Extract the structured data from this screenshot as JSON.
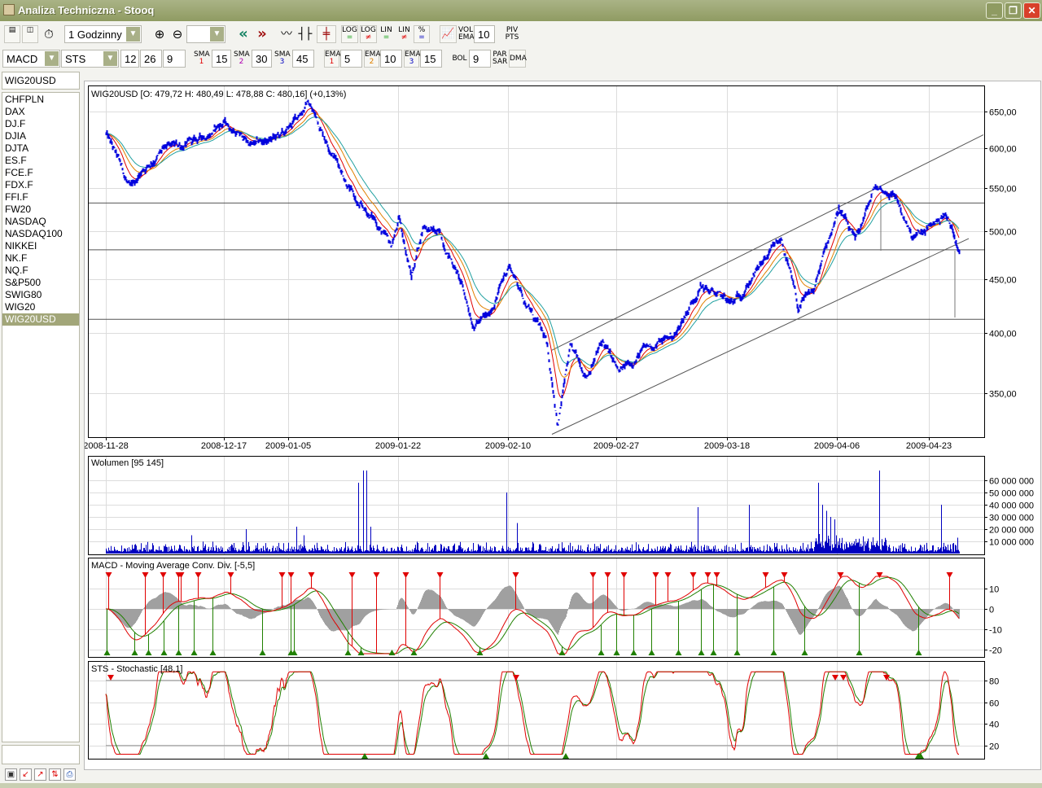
{
  "window": {
    "title": "Analiza Techniczna - Stooq",
    "minimize": "_",
    "restore": "❐",
    "close": "✕"
  },
  "toolbar1": {
    "interval": "1 Godzinny",
    "zoom_select": "",
    "log_eq": [
      "LOG",
      "="
    ],
    "log_neq": [
      "LOG",
      "≠"
    ],
    "lin_eq": [
      "LIN",
      "="
    ],
    "lin_neq": [
      "LIN",
      "≠"
    ],
    "pct": [
      "%",
      "="
    ],
    "vol_ema": [
      "VOL",
      "EMA"
    ],
    "vol_ema_value": "10",
    "piv_pts": [
      "PIV",
      "PTS"
    ],
    "back": "«",
    "forward": "»"
  },
  "toolbar2": {
    "indicator1": "MACD",
    "indicator2": "STS",
    "macd_params": [
      "12",
      "26",
      "9"
    ],
    "sma": [
      {
        "label": "SMA",
        "n": "1",
        "value": "15",
        "color": "#e00000"
      },
      {
        "label": "SMA",
        "n": "2",
        "value": "30",
        "color": "#b000b0"
      },
      {
        "label": "SMA",
        "n": "3",
        "value": "45",
        "color": "#0000c0"
      }
    ],
    "ema": [
      {
        "label": "EMA",
        "n": "1",
        "value": "5",
        "color": "#e00000"
      },
      {
        "label": "EMA",
        "n": "2",
        "value": "10",
        "color": "#e08000"
      },
      {
        "label": "EMA",
        "n": "3",
        "value": "15",
        "color": "#0000c0"
      }
    ],
    "bol": "BOL",
    "bol_value": "9",
    "par_sar": [
      "PAR",
      "SAR"
    ],
    "dma": "DMA"
  },
  "sidebar": {
    "search": "WIG20USD",
    "items": [
      "CHFPLN",
      "DAX",
      "DJ.F",
      "DJIA",
      "DJTA",
      "ES.F",
      "FCE.F",
      "FDX.F",
      "FFI.F",
      "FW20",
      "NASDAQ",
      "NASDAQ100",
      "NIKKEI",
      "NK.F",
      "NQ.F",
      "S&P500",
      "SWIG80",
      "WIG20",
      "WIG20USD"
    ],
    "selected": "WIG20USD"
  },
  "chart_data": {
    "type": "line",
    "price": {
      "title": "WIG20USD [O: 479,72  H: 480,49  L: 478,88  C: 480,16] (+0,13%)",
      "ylim": [
        320,
        670
      ],
      "yticks": [
        350,
        400,
        450,
        500,
        550,
        600,
        650
      ],
      "ytick_labels": [
        "350,00",
        "400,00",
        "450,00",
        "500,00",
        "550,00",
        "600,00",
        "650,00"
      ],
      "bar_count": 1049,
      "keypoints": [
        [
          0,
          619
        ],
        [
          20,
          571
        ],
        [
          30,
          546
        ],
        [
          45,
          573
        ],
        [
          70,
          597
        ],
        [
          110,
          608
        ],
        [
          145,
          635
        ],
        [
          180,
          603
        ],
        [
          220,
          618
        ],
        [
          248,
          665
        ],
        [
          270,
          613
        ],
        [
          290,
          571
        ],
        [
          310,
          527
        ],
        [
          330,
          513
        ],
        [
          350,
          482
        ],
        [
          360,
          513
        ],
        [
          375,
          452
        ],
        [
          390,
          508
        ],
        [
          410,
          495
        ],
        [
          430,
          460
        ],
        [
          450,
          410
        ],
        [
          470,
          414
        ],
        [
          495,
          465
        ],
        [
          515,
          429
        ],
        [
          540,
          392
        ],
        [
          555,
          328
        ],
        [
          570,
          385
        ],
        [
          590,
          365
        ],
        [
          610,
          392
        ],
        [
          630,
          365
        ],
        [
          660,
          385
        ],
        [
          700,
          399
        ],
        [
          730,
          444
        ],
        [
          770,
          425
        ],
        [
          790,
          448
        ],
        [
          830,
          490
        ],
        [
          850,
          421
        ],
        [
          870,
          440
        ],
        [
          900,
          527
        ],
        [
          920,
          486
        ],
        [
          945,
          551
        ],
        [
          970,
          541
        ],
        [
          990,
          490
        ],
        [
          1010,
          502
        ],
        [
          1030,
          520
        ],
        [
          1048,
          482
        ]
      ],
      "hlines": [
        532,
        480,
        412
      ],
      "channel_lower": [
        [
          548,
          320
        ],
        [
          1060,
          492
        ]
      ],
      "channel_upper": [
        [
          548,
          385
        ],
        [
          1078,
          618
        ]
      ],
      "ma_periods": [
        5,
        10,
        15
      ],
      "ma_colors": [
        "#e00000",
        "#e08000",
        "#20a0a0"
      ],
      "bar_color": "#0000dd"
    },
    "x_ticks": [
      {
        "bar": 0,
        "label": "2008-11-28"
      },
      {
        "bar": 145,
        "label": "2008-12-17"
      },
      {
        "bar": 224,
        "label": "2009-01-05"
      },
      {
        "bar": 359,
        "label": "2009-01-22"
      },
      {
        "bar": 494,
        "label": "2009-02-10"
      },
      {
        "bar": 627,
        "label": "2009-02-27"
      },
      {
        "bar": 763,
        "label": "2009-03-18"
      },
      {
        "bar": 898,
        "label": "2009-04-06"
      },
      {
        "bar": 1011,
        "label": "2009-04-23"
      }
    ],
    "volume": {
      "title": "Wolumen [95 145]",
      "yticks": [
        10000000,
        20000000,
        30000000,
        40000000,
        50000000,
        60000000
      ],
      "ytick_labels": [
        "10 000 000",
        "20 000 000",
        "30 000 000",
        "40 000 000",
        "50 000 000",
        "60 000 000"
      ],
      "spikes": [
        [
          105,
          15000000
        ],
        [
          172,
          20000000
        ],
        [
          234,
          22000000
        ],
        [
          243,
          15000000
        ],
        [
          310,
          58000000
        ],
        [
          316,
          68000000
        ],
        [
          320,
          68000000
        ],
        [
          325,
          22000000
        ],
        [
          492,
          50000000
        ],
        [
          505,
          25000000
        ],
        [
          727,
          38000000
        ],
        [
          790,
          40000000
        ],
        [
          875,
          58000000
        ],
        [
          880,
          40000000
        ],
        [
          885,
          35000000
        ],
        [
          890,
          30000000
        ],
        [
          895,
          28000000
        ],
        [
          950,
          68000000
        ],
        [
          1026,
          40000000
        ],
        [
          1046,
          13000000
        ]
      ]
    },
    "macd": {
      "title": "MACD - Moving Average Conv. Div. [-5,5]",
      "params": [
        12,
        26,
        9
      ],
      "yticks": [
        10,
        0,
        -10,
        -20
      ],
      "ytick_labels": [
        "10",
        "0",
        "-10",
        "-20"
      ],
      "sell_markers": [
        3,
        48,
        70,
        89,
        92,
        113,
        153,
        216,
        227,
        252,
        302,
        332,
        368,
        410,
        503,
        598,
        616,
        636,
        675,
        690,
        721,
        739,
        750,
        810,
        833,
        902,
        950,
        1036
      ],
      "buy_markers": [
        1,
        35,
        52,
        71,
        89,
        108,
        131,
        192,
        227,
        231,
        297,
        313,
        351,
        378,
        459,
        560,
        608,
        627,
        648,
        670,
        703,
        731,
        746,
        775,
        820,
        858,
        925,
        998
      ],
      "colors": {
        "macd": "#e00000",
        "signal": "#208000",
        "histogram": "#a0a0a0"
      }
    },
    "sts": {
      "title": "STS - Stochastic [48,1]",
      "period": 48,
      "yticks": [
        80,
        60,
        40,
        20
      ],
      "ytick_labels": [
        "80",
        "60",
        "40",
        "20"
      ],
      "levels": [
        80,
        20
      ],
      "sell_markers": [
        6,
        504,
        896,
        906,
        959
      ],
      "buy_markers": [
        318,
        467,
        565,
        998,
        1001
      ]
    }
  }
}
